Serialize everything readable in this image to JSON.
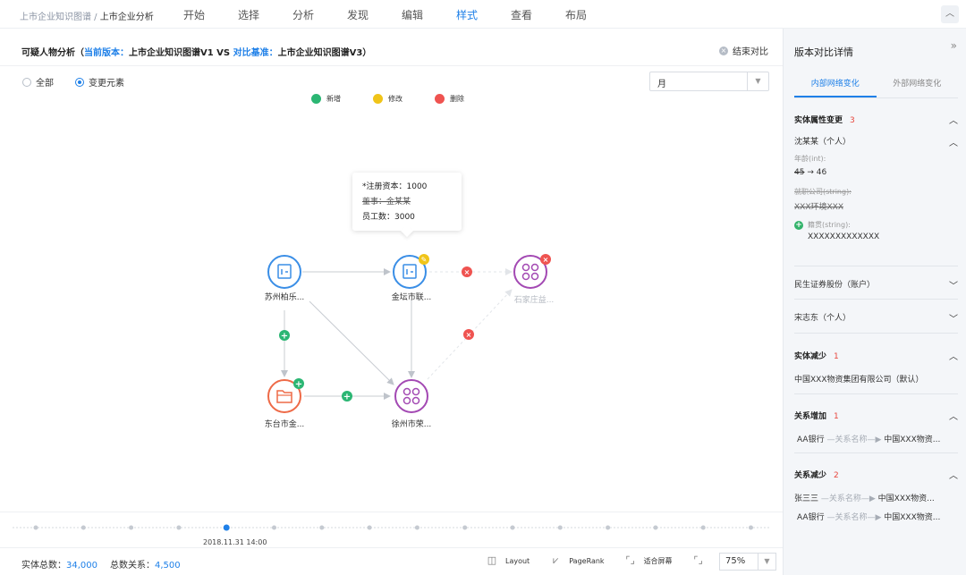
{
  "topbar": {
    "crumb_root": "上市企业知识图谱 / ",
    "crumb_current": "上市企业分析",
    "menu": [
      "开始",
      "选择",
      "分析",
      "发现",
      "编辑",
      "样式",
      "查看",
      "布局"
    ],
    "collapse_icon": "chevron-up-icon"
  },
  "header": {
    "title_prefix": "可疑人物分析（",
    "current_label": "当前版本：",
    "current_value": "上市企业知识图谱V1",
    "vs": " VS ",
    "base_label": "对比基准：",
    "base_value": "上市企业知识图谱V3）",
    "end_compare": "结束对比"
  },
  "filters": {
    "all": "全部",
    "changed": "变更元素",
    "period": "月"
  },
  "legend": [
    {
      "label": "新增",
      "color": "#2bb673"
    },
    {
      "label": "修改",
      "color": "#f0c419"
    },
    {
      "label": "删除",
      "color": "#ef5350"
    }
  ],
  "tooltip": {
    "line1": "*注册资本：1000",
    "line2": "董事：金某某",
    "line3": "员工数：3000"
  },
  "nodes": {
    "suzhou": "苏州柏乐...",
    "jintan": "金坛市联...",
    "shijiazhuang": "石家庄益...",
    "dongtai": "东台市金...",
    "xuzhou": "徐州市荣..."
  },
  "timeline": {
    "date": "2018.11.31 14:00",
    "dot_count": 16,
    "active_index": 4
  },
  "footer": {
    "entity_total_label": "实体总数：",
    "entity_total": "34,000",
    "relation_total_label": "总数关系：",
    "relation_total": "4,500",
    "layout": "Layout",
    "pagerank": "PageRank",
    "fit": "适合屏幕",
    "zoom": "75%"
  },
  "side": {
    "title": "版本对比详情",
    "tab_internal": "内部网络变化",
    "tab_external": "外部网络变化",
    "attr_change": {
      "title": "实体属性变更",
      "count": "3"
    },
    "person1": {
      "name": "沈某某（个人）",
      "age_label": "年龄(int):",
      "age_old": "45",
      "age_arrow": "→",
      "age_new": "46",
      "job_label": "就职公司(string):",
      "job_value": "XXX环境XXX",
      "origin_label": "籍贯(string):",
      "origin_value": "XXXXXXXXXXXXX"
    },
    "item2": "民生证券股份（账户）",
    "item3": "宋志东（个人）",
    "entity_dec": {
      "title": "实体减少",
      "count": "1",
      "value": "中国XXX物资集团有限公司（默认）"
    },
    "rel_inc": {
      "title": "关系增加",
      "count": "1",
      "from": "AA银行",
      "mid": " —关系名称—▶ ",
      "to": "中国XXX物资..."
    },
    "rel_dec": {
      "title": "关系减少",
      "count": "2",
      "r1_from": "张三三",
      "r1_mid": " —关系名称—▶ ",
      "r1_to": "中国XXX物资...",
      "r2_from": "AA银行",
      "r2_mid": " —关系名称—▶ ",
      "r2_to": "中国XXX物资..."
    }
  }
}
